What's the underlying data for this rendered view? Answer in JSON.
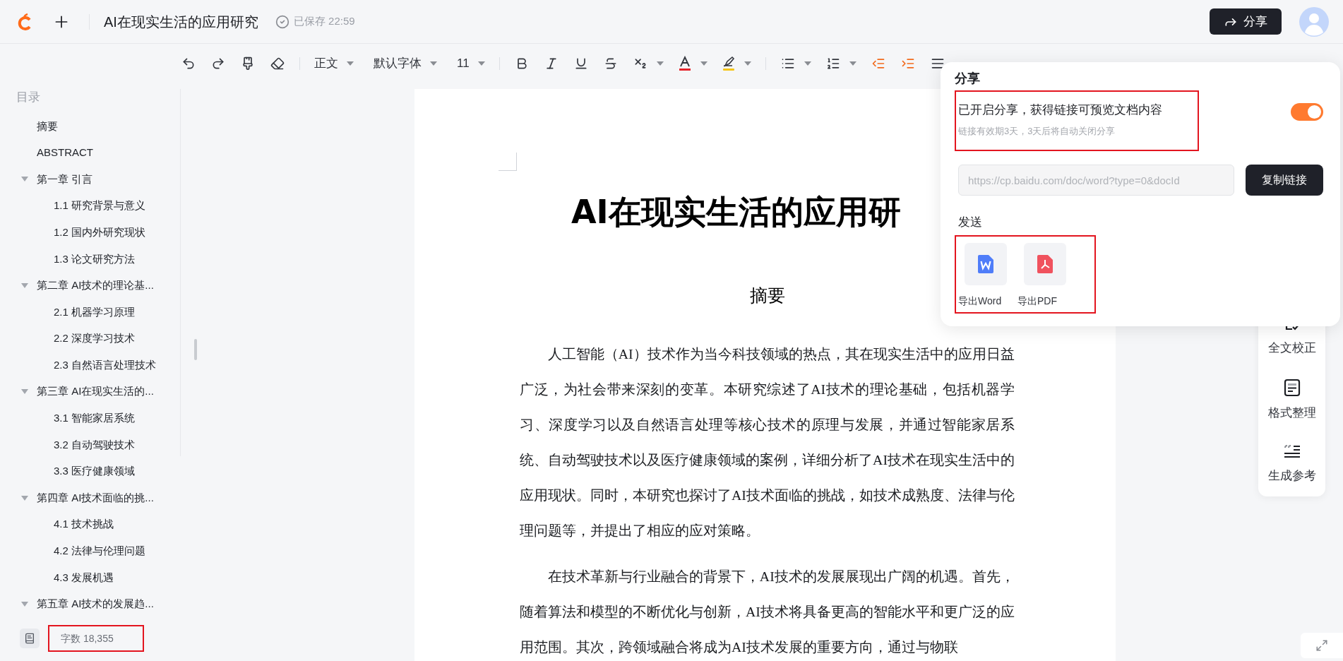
{
  "header": {
    "title": "AI在现实生活的应用研究",
    "save_status": "已保存 22:59",
    "share_button": "分享"
  },
  "toolbar": {
    "paragraph_style": "正文",
    "font_family": "默认字体",
    "font_size": "11"
  },
  "sidebar": {
    "title": "目录",
    "toc": [
      {
        "label": "摘要"
      },
      {
        "label": "ABSTRACT"
      },
      {
        "label": "第一章 引言",
        "expanded": true,
        "children": [
          {
            "label": "1.1 研究背景与意义"
          },
          {
            "label": "1.2 国内外研究现状"
          },
          {
            "label": "1.3 论文研究方法"
          }
        ]
      },
      {
        "label": "第二章 AI技术的理论基...",
        "expanded": true,
        "children": [
          {
            "label": "2.1 机器学习原理"
          },
          {
            "label": "2.2 深度学习技术"
          },
          {
            "label": "2.3 自然语言处理技术"
          }
        ]
      },
      {
        "label": "第三章 AI在现实生活的...",
        "expanded": true,
        "children": [
          {
            "label": "3.1 智能家居系统"
          },
          {
            "label": "3.2 自动驾驶技术"
          },
          {
            "label": "3.3 医疗健康领域"
          }
        ]
      },
      {
        "label": "第四章 AI技术面临的挑...",
        "expanded": true,
        "children": [
          {
            "label": "4.1 技术挑战"
          },
          {
            "label": "4.2 法律与伦理问题"
          },
          {
            "label": "4.3 发展机遇"
          }
        ]
      },
      {
        "label": "第五章 AI技术的发展趋...",
        "expanded": true
      }
    ],
    "word_count": "字数 18,355"
  },
  "document": {
    "title": "AI在现实生活的应用研",
    "heading": "摘要",
    "paragraphs": [
      "人工智能（AI）技术作为当今科技领域的热点，其在现实生活中的应用日益广泛，为社会带来深刻的变革。本研究综述了AI技术的理论基础，包括机器学习、深度学习以及自然语言处理等核心技术的原理与发展，并通过智能家居系统、自动驾驶技术以及医疗健康领域的案例，详细分析了AI技术在现实生活中的应用现状。同时，本研究也探讨了AI技术面临的挑战，如技术成熟度、法律与伦理问题等，并提出了相应的应对策略。",
      "在技术革新与行业融合的背景下，AI技术的发展展现出广阔的机遇。首先，随着算法和模型的不断优化与创新，AI技术将具备更高的智能水平和更广泛的应用范围。其次，跨领域融合将成为AI技术发展的重要方向，通过与物联"
    ]
  },
  "share_panel": {
    "title": "分享",
    "status": "已开启分享，获得链接可预览文档内容",
    "note": "链接有效期3天，3天后将自动关闭分享",
    "enabled": true,
    "link": "https://cp.baidu.com/doc/word?type=0&docId",
    "copy_button": "复制链接",
    "send_title": "发送",
    "exports": [
      {
        "kind": "word",
        "label": "导出Word"
      },
      {
        "kind": "pdf",
        "label": "导出PDF"
      }
    ]
  },
  "tools": [
    {
      "kind": "proofread",
      "label": "全文校正"
    },
    {
      "kind": "format",
      "label": "格式整理"
    },
    {
      "kind": "reference",
      "label": "生成参考"
    }
  ]
}
